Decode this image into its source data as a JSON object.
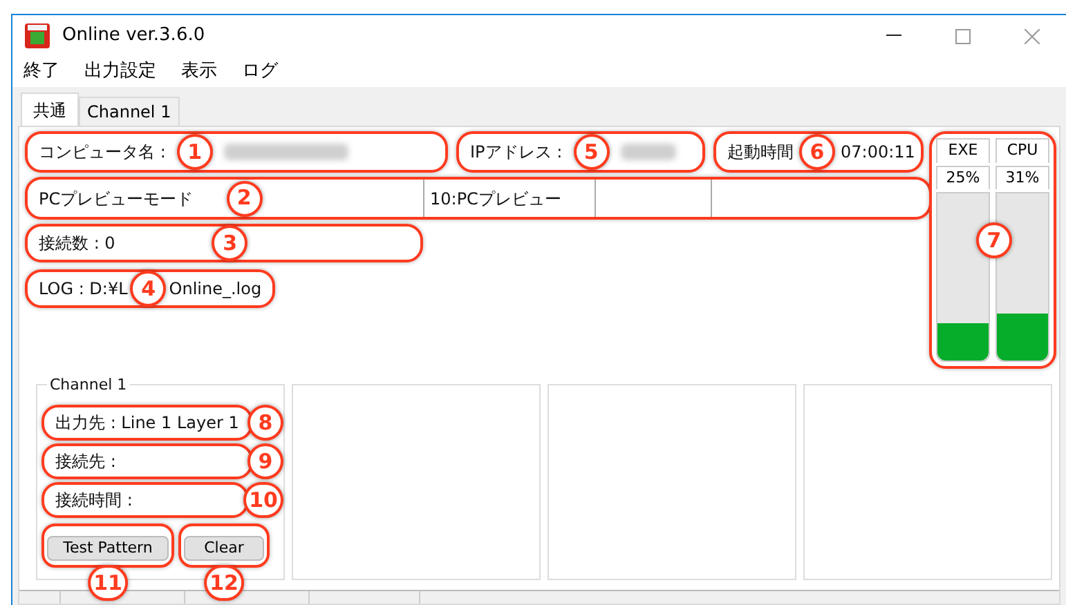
{
  "window": {
    "title": "Online ver.3.6.0"
  },
  "menu": [
    "終了",
    "出力設定",
    "表示",
    "ログ"
  ],
  "tabs": [
    {
      "label": "共通",
      "selected": true
    },
    {
      "label": "Channel 1",
      "selected": false
    }
  ],
  "computer_name": {
    "label": "コンピュータ名 :",
    "callout": "1"
  },
  "ip_address": {
    "label": "IPアドレス :",
    "callout": "5"
  },
  "uptime": {
    "label": "起動時間",
    "value": "07:00:11",
    "callout": "6"
  },
  "preview_mode": {
    "label": "PCプレビューモード",
    "callout": "2",
    "value": "10:PCプレビュー"
  },
  "connections": {
    "label": "接続数 : 0",
    "callout": "3"
  },
  "log": {
    "label": "LOG : D:¥L",
    "file": "Online_.log",
    "callout": "4"
  },
  "meters": {
    "callout": "7",
    "items": [
      {
        "label": "EXE",
        "reading": "25%",
        "level": 0.22
      },
      {
        "label": "CPU",
        "reading": "31%",
        "level": 0.28
      }
    ]
  },
  "channel": {
    "title": "Channel 1",
    "fields": [
      {
        "label": "出力先 : Line 1 Layer 1",
        "callout": "8"
      },
      {
        "label": "接続先 :",
        "callout": "9"
      },
      {
        "label": "接続時間 :",
        "callout": "10"
      }
    ],
    "buttons": [
      {
        "label": "Test Pattern",
        "callout": "11"
      },
      {
        "label": "Clear",
        "callout": "12"
      }
    ]
  }
}
